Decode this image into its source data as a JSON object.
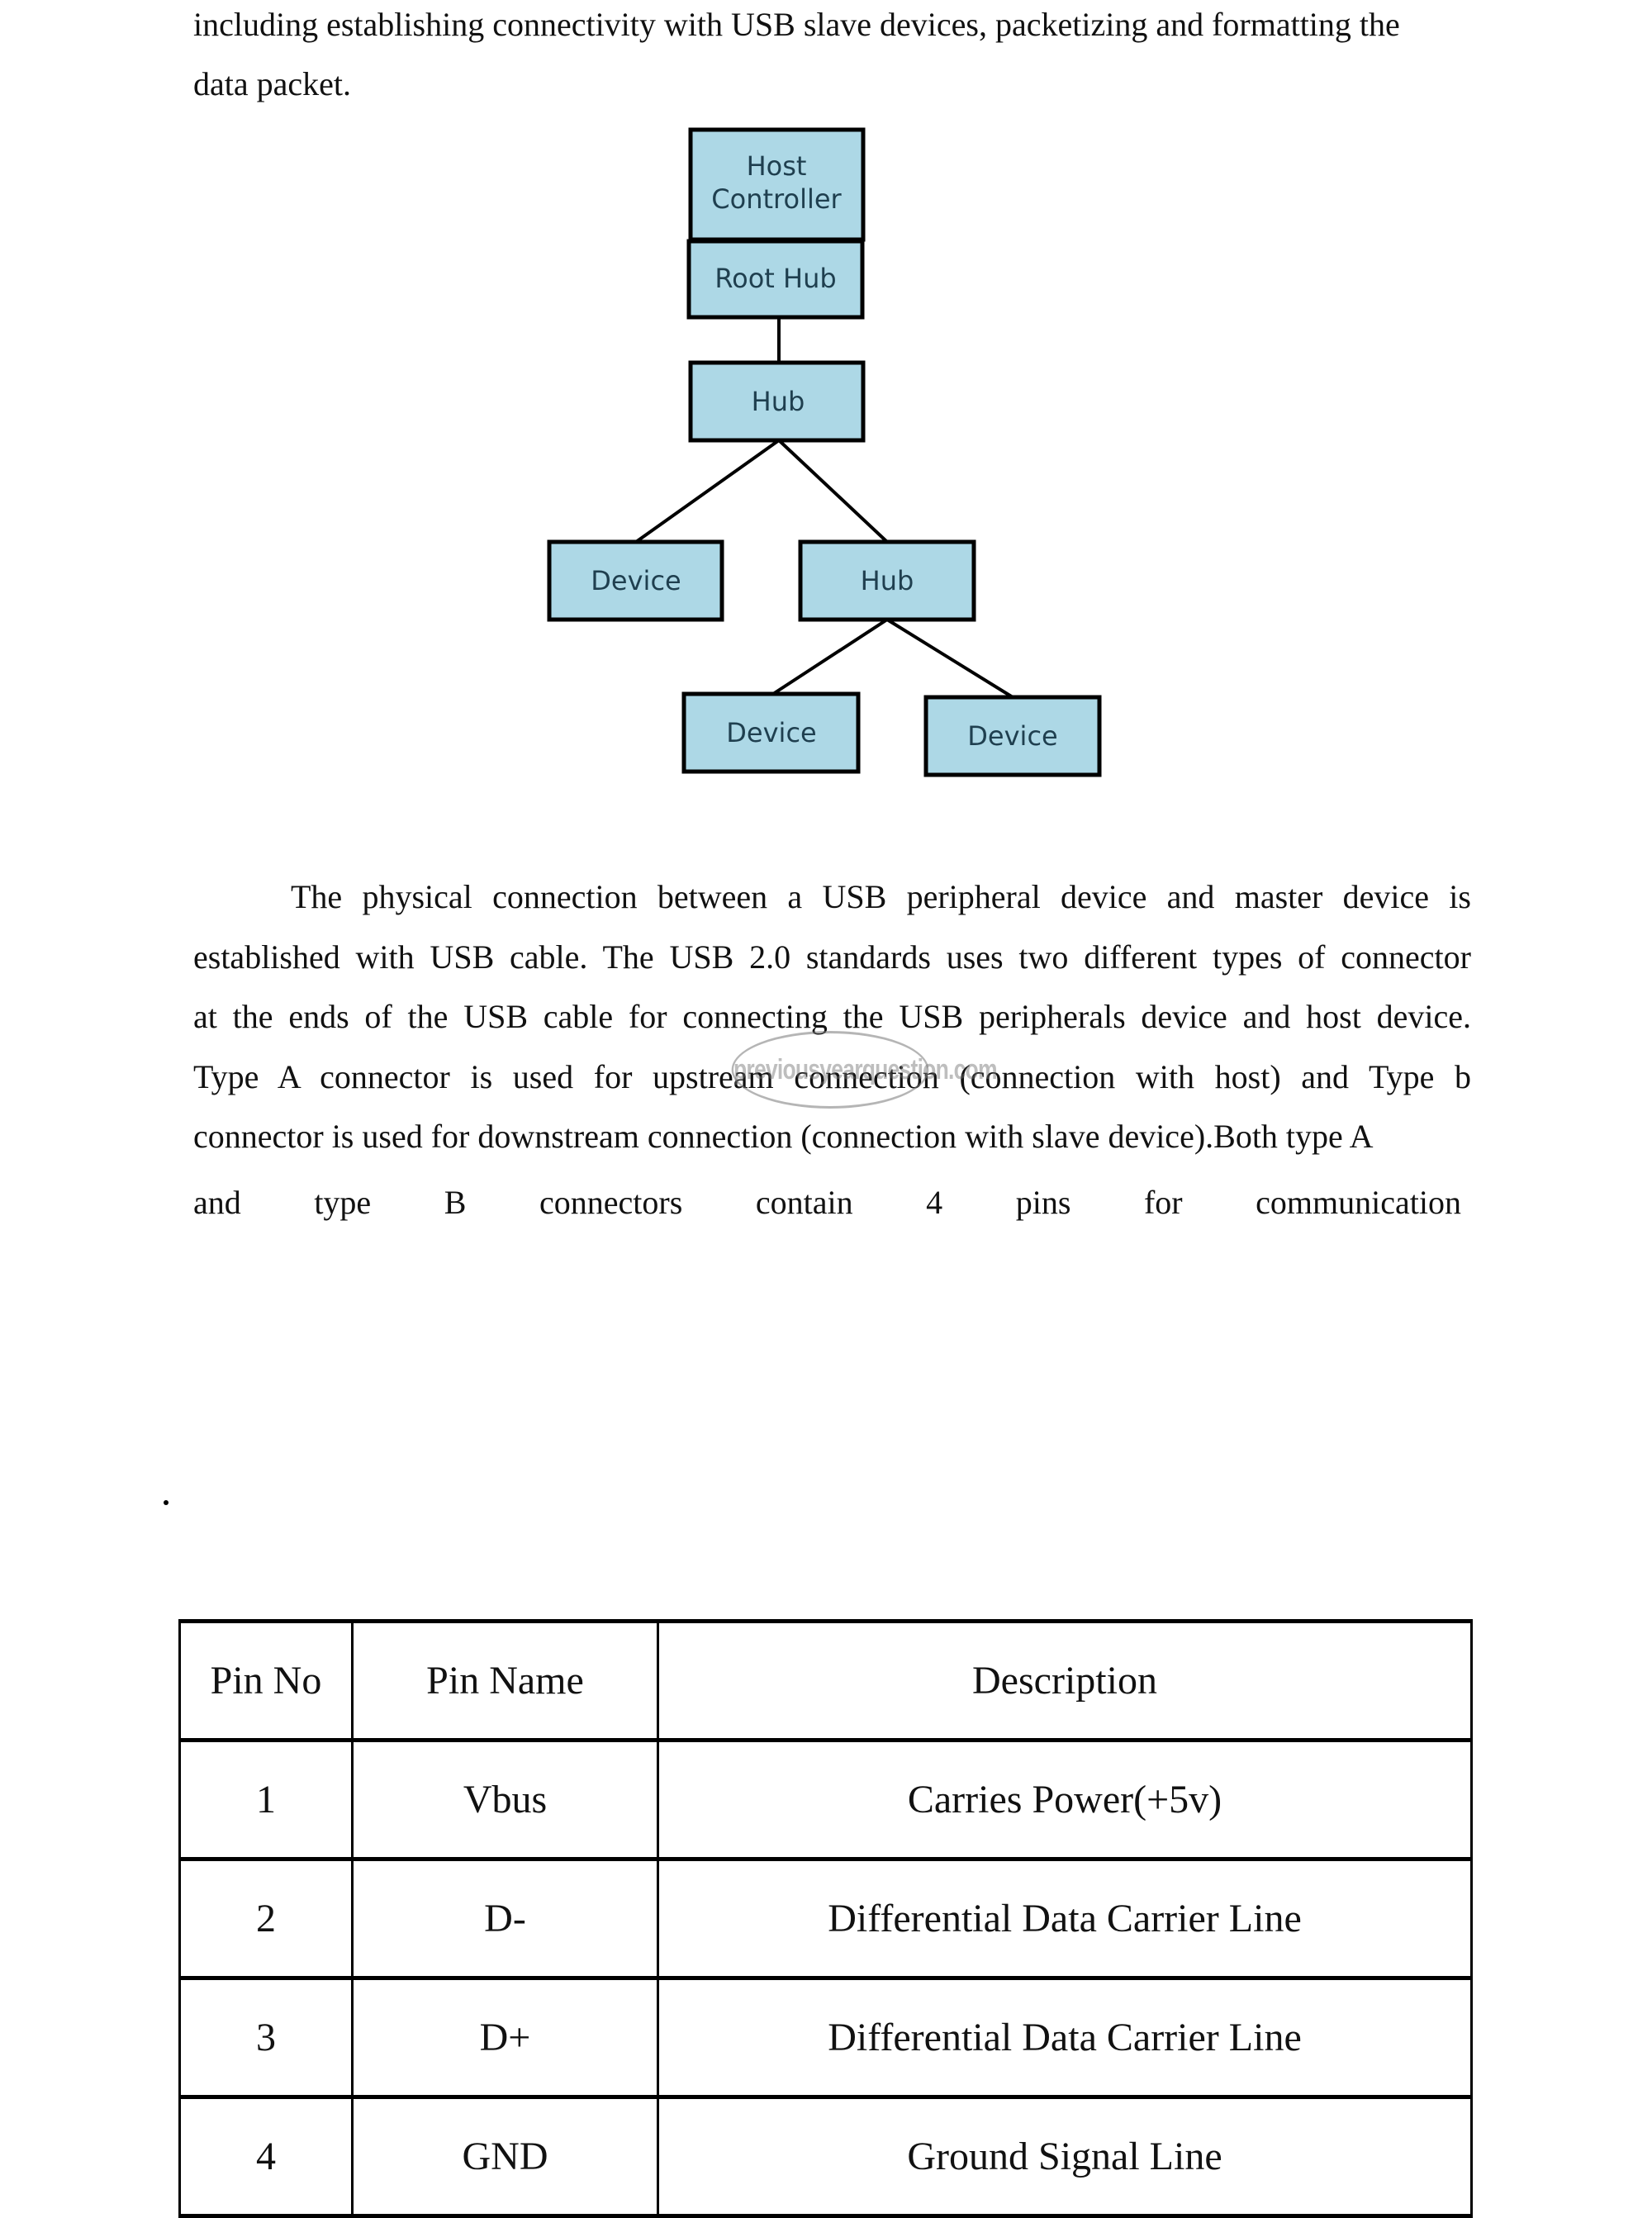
{
  "intro": {
    "line1": "including establishing connectivity with USB slave devices, packetizing and formatting the",
    "line2": "data packet."
  },
  "diagram": {
    "nodes": {
      "host_controller": [
        "Host",
        "Controller"
      ],
      "root_hub": "Root Hub",
      "hub1": "Hub",
      "device1": "Device",
      "hub2": "Hub",
      "device2": "Device",
      "device3": "Device"
    },
    "edges": [
      [
        "root_hub",
        "hub1"
      ],
      [
        "hub1",
        "device1"
      ],
      [
        "hub1",
        "hub2"
      ],
      [
        "hub2",
        "device2"
      ],
      [
        "hub2",
        "device3"
      ]
    ],
    "colors": {
      "box_fill": "#ADD8E6",
      "box_text": "#1F3F4F",
      "border": "#000000"
    }
  },
  "paragraph": {
    "lines": [
      "The physical connection between a USB peripheral device and master device is",
      "established with USB cable. The USB 2.0 standards uses two different types of connector",
      "at the ends of the USB cable for connecting the USB peripherals device and host device.",
      "Type A connector is used for upstream connection (connection with host) and Type b",
      "connector is used for downstream connection (connection with slave device).Both type A",
      "and type B connectors contain 4 pins for communication"
    ]
  },
  "watermark": "previousyearquestion.com",
  "stray_mark": ".",
  "pin_table": {
    "headers": [
      "Pin No",
      "Pin Name",
      "Description"
    ],
    "rows": [
      [
        "1",
        "Vbus",
        "Carries Power(+5v)"
      ],
      [
        "2",
        "D-",
        "Differential Data Carrier Line"
      ],
      [
        "3",
        "D+",
        "Differential Data Carrier Line"
      ],
      [
        "4",
        "GND",
        "Ground Signal Line"
      ]
    ]
  }
}
